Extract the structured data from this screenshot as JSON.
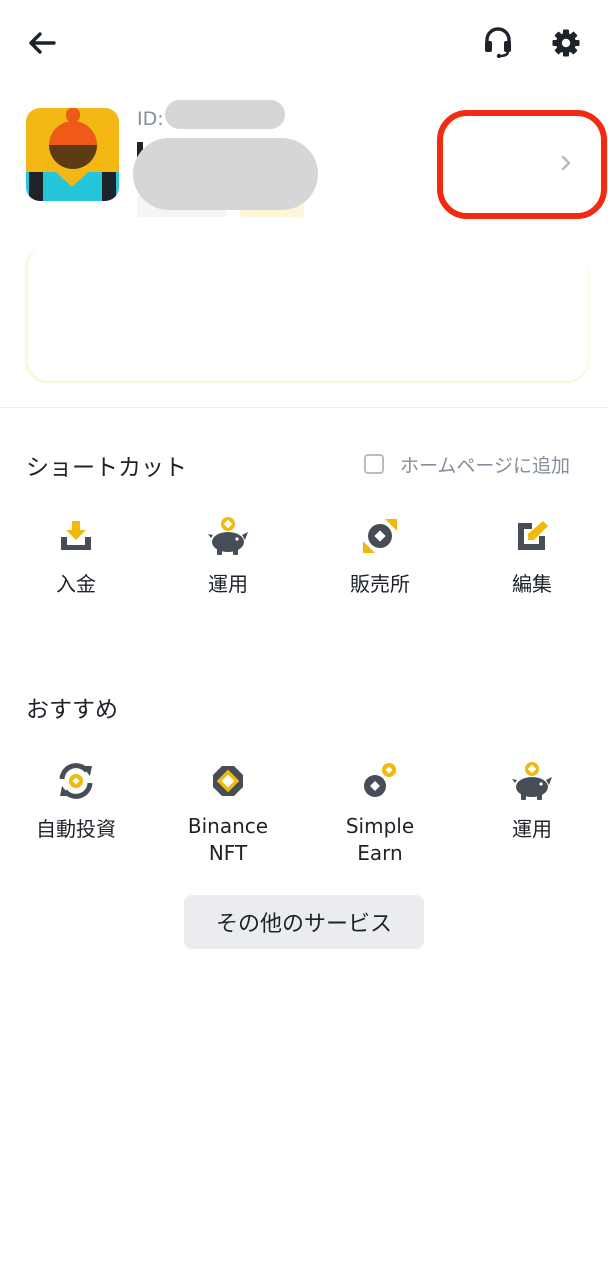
{
  "header": {
    "back_icon": "arrow-left-icon",
    "support_icon": "headset-icon",
    "settings_icon": "gear-icon"
  },
  "profile": {
    "id_label": "ID:"
  },
  "shortcuts": {
    "title": "ショートカット",
    "add_to_home_label": "ホームページに追加",
    "items": [
      {
        "label": "入金",
        "icon": "deposit-icon"
      },
      {
        "label": "運用",
        "icon": "piggy-bank-icon"
      },
      {
        "label": "販売所",
        "icon": "convert-icon"
      },
      {
        "label": "編集",
        "icon": "edit-icon"
      }
    ]
  },
  "recommended": {
    "title": "おすすめ",
    "items": [
      {
        "label": "自動投資",
        "icon": "auto-invest-icon"
      },
      {
        "label": "Binance\nNFT",
        "icon": "nft-icon"
      },
      {
        "label": "Simple\nEarn",
        "icon": "simple-earn-icon"
      },
      {
        "label": "運用",
        "icon": "piggy-bank-icon"
      }
    ]
  },
  "more_services_label": "その他のサービス",
  "colors": {
    "accent": "#f0b90b",
    "icon_dark": "#474d57",
    "highlight": "#f32a12"
  }
}
